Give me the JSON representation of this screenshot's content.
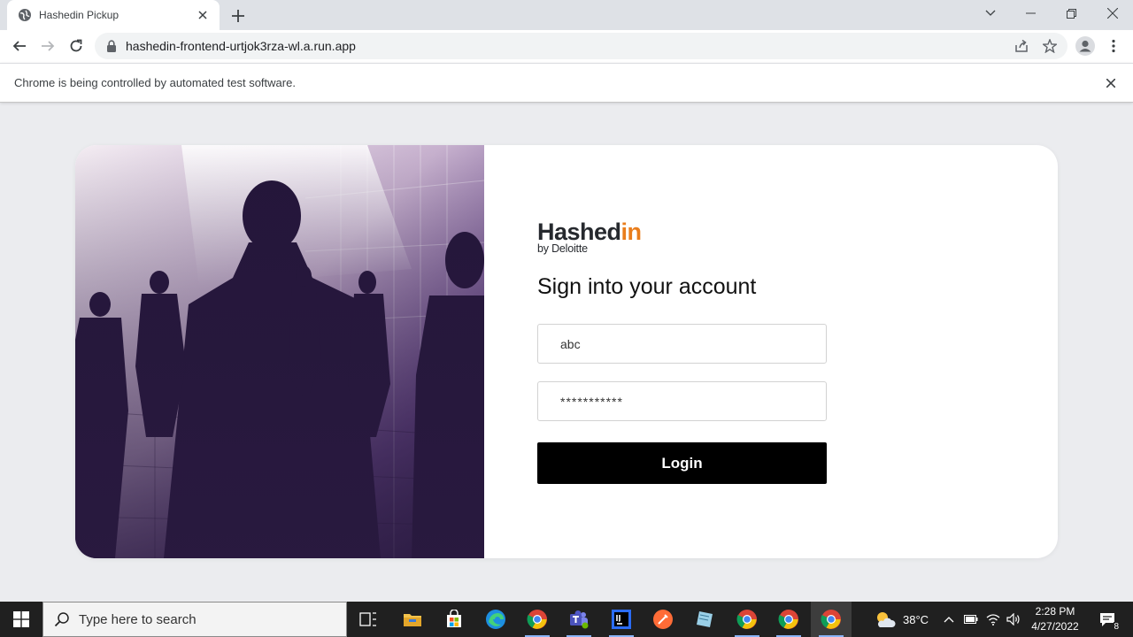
{
  "browser": {
    "tab_title": "Hashedin Pickup",
    "url": "hashedin-frontend-urtjok3rza-wl.a.run.app",
    "infobar_message": "Chrome is being controlled by automated test software."
  },
  "login": {
    "logo_word_main": "Hashed",
    "logo_word_accent": "in",
    "logo_sub": "by Deloitte",
    "heading": "Sign into your account",
    "username_value": "abc",
    "password_value": "***********",
    "login_label": "Login"
  },
  "taskbar": {
    "search_placeholder": "Type here to search",
    "temperature": "38°C",
    "time": "2:28 PM",
    "date": "4/27/2022",
    "notification_count": "8"
  },
  "colors": {
    "brand_accent": "#e97d1c",
    "button_bg": "#000000",
    "page_bg": "#ebecef"
  }
}
